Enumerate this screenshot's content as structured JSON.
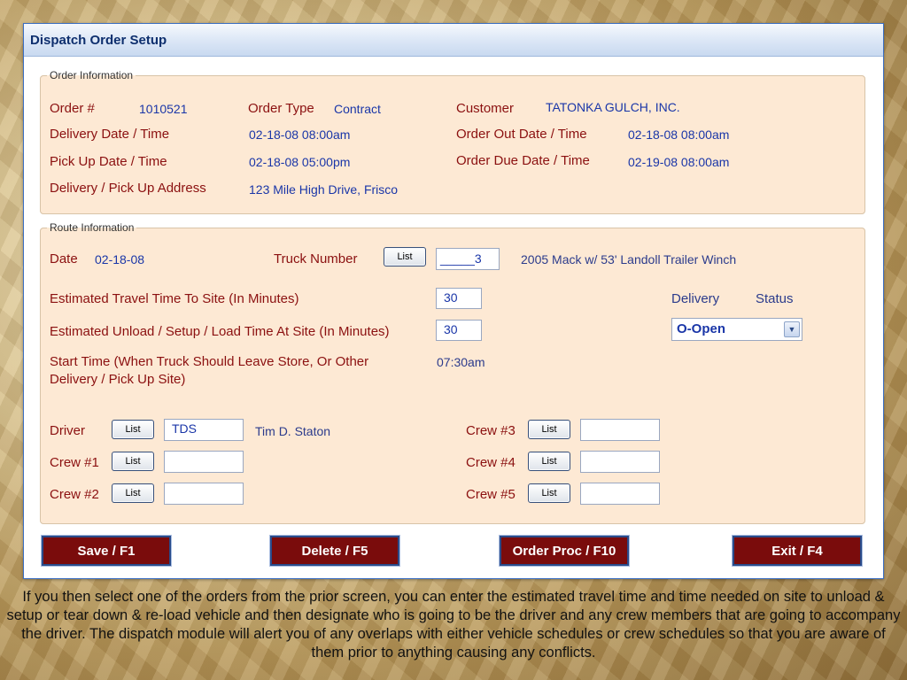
{
  "window": {
    "title": "Dispatch Order Setup"
  },
  "order_info": {
    "legend": "Order Information",
    "order_no_label": "Order #",
    "order_no": "1010521",
    "order_type_label": "Order Type",
    "order_type": "Contract",
    "customer_label": "Customer",
    "customer": "TATONKA GULCH, INC.",
    "delivery_dt_label": "Delivery Date / Time",
    "delivery_dt": "02-18-08 08:00am",
    "order_out_label": "Order Out Date / Time",
    "order_out": "02-18-08 08:00am",
    "pickup_dt_label": "Pick Up Date / Time",
    "pickup_dt": "02-18-08 05:00pm",
    "order_due_label": "Order Due Date / Time",
    "order_due": "02-19-08 08:00am",
    "address_label": "Delivery / Pick Up Address",
    "address": "123 Mile High Drive, Frisco"
  },
  "route_info": {
    "legend": "Route Information",
    "date_label": "Date",
    "date": "02-18-08",
    "truck_label": "Truck Number",
    "list_label": "List",
    "truck_value": "_____3",
    "truck_desc": "2005 Mack w/ 53' Landoll Trailer  Winch",
    "travel_label": "Estimated Travel Time To Site (In Minutes)",
    "travel_value": "30",
    "unload_label": "Estimated Unload / Setup / Load Time At Site (In Minutes)",
    "unload_value": "30",
    "delivery_label": "Delivery",
    "status_label": "Status",
    "status_value": "O-Open",
    "start_label_1": "Start Time (When Truck Should Leave Store, Or Other",
    "start_label_2": "Delivery / Pick Up Site)",
    "start_value": "07:30am",
    "driver_label": "Driver",
    "driver_code": "TDS",
    "driver_name": "Tim D. Staton",
    "crew1_label": "Crew #1",
    "crew1_value": "",
    "crew2_label": "Crew #2",
    "crew2_value": "",
    "crew3_label": "Crew #3",
    "crew3_value": "",
    "crew4_label": "Crew #4",
    "crew4_value": "",
    "crew5_label": "Crew #5",
    "crew5_value": ""
  },
  "actions": {
    "save": "Save / F1",
    "delete": "Delete / F5",
    "order_proc": "Order Proc / F10",
    "exit": "Exit / F4"
  },
  "caption": "If you then select one of the orders from the prior screen, you can enter the estimated travel time and time needed on site to unload & setup or tear down & re-load vehicle and then designate who is going to be the driver and any crew members that are going to accompany the driver. The dispatch module will alert you of any overlaps with either vehicle schedules or crew schedules so that you are aware of them prior to anything causing any conflicts.",
  "colors": {
    "label_red": "#8b1010",
    "value_blue": "#1a36a8",
    "panel_bg": "#fde9d4",
    "action_button": "#7a0c0c"
  }
}
